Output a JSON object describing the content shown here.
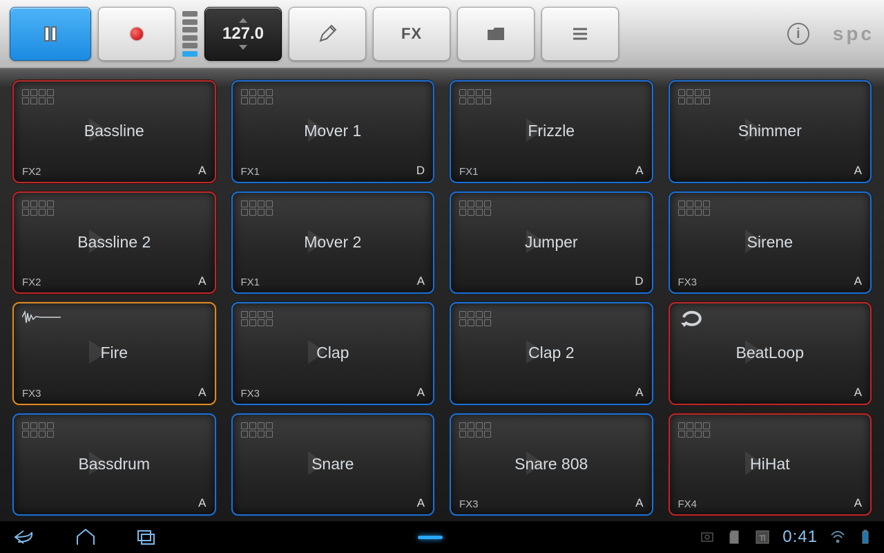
{
  "toolbar": {
    "bpm": "127.0",
    "fx_label": "FX",
    "brand": "spc"
  },
  "colors": {
    "red": "red",
    "blue": "blue",
    "orange": "orange"
  },
  "pads": [
    {
      "name": "Bassline",
      "fx": "FX2",
      "bank": "A",
      "color": "red",
      "icon": "grid"
    },
    {
      "name": "Mover 1",
      "fx": "FX1",
      "bank": "D",
      "color": "blue",
      "icon": "grid"
    },
    {
      "name": "Frizzle",
      "fx": "FX1",
      "bank": "A",
      "color": "blue",
      "icon": "grid"
    },
    {
      "name": "Shimmer",
      "fx": "",
      "bank": "A",
      "color": "blue",
      "icon": "grid"
    },
    {
      "name": "Bassline 2",
      "fx": "FX2",
      "bank": "A",
      "color": "red",
      "icon": "grid"
    },
    {
      "name": "Mover 2",
      "fx": "FX1",
      "bank": "A",
      "color": "blue",
      "icon": "grid"
    },
    {
      "name": "Jumper",
      "fx": "",
      "bank": "D",
      "color": "blue",
      "icon": "grid"
    },
    {
      "name": "Sirene",
      "fx": "FX3",
      "bank": "A",
      "color": "blue",
      "icon": "grid"
    },
    {
      "name": "Fire",
      "fx": "FX3",
      "bank": "A",
      "color": "orange",
      "icon": "wave"
    },
    {
      "name": "Clap",
      "fx": "FX3",
      "bank": "A",
      "color": "blue",
      "icon": "grid"
    },
    {
      "name": "Clap 2",
      "fx": "",
      "bank": "A",
      "color": "blue",
      "icon": "grid"
    },
    {
      "name": "BeatLoop",
      "fx": "",
      "bank": "A",
      "color": "red",
      "icon": "loop"
    },
    {
      "name": "Bassdrum",
      "fx": "",
      "bank": "A",
      "color": "blue",
      "icon": "grid"
    },
    {
      "name": "Snare",
      "fx": "",
      "bank": "A",
      "color": "blue",
      "icon": "grid"
    },
    {
      "name": "Snare 808",
      "fx": "FX3",
      "bank": "A",
      "color": "blue",
      "icon": "grid"
    },
    {
      "name": "HiHat",
      "fx": "FX4",
      "bank": "A",
      "color": "red",
      "icon": "grid"
    }
  ],
  "statusbar": {
    "time": "0:41"
  }
}
